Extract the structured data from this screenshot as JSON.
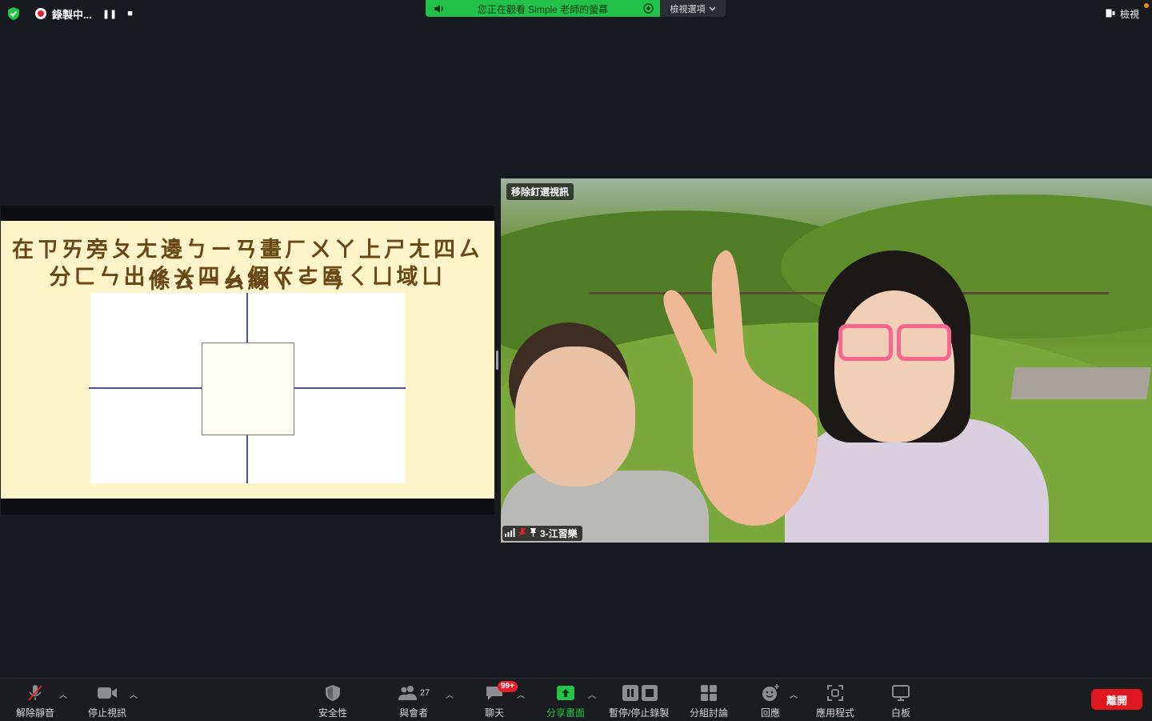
{
  "top_bar": {
    "recording_label": "錄製中...",
    "pause_symbol": "❚❚",
    "stop_symbol": "■",
    "banner_text": "您正在觀看 Simple 老師的螢幕",
    "view_options_label": "檢視選項",
    "view_label": "檢視"
  },
  "slide": {
    "title_line1": "在ㄗㄞ旁ㄆㄤ邊ㄅㄧㄢ畫ㄏㄨㄚ上ㄕㄤ四ㄙ條ㄊㄧㄠ線ㄒㄧㄢ",
    "title_line2": "分ㄈㄣ出ㄔㄨ四ㄙ個ㄍㄜ區ㄑㄩ域ㄩ"
  },
  "video": {
    "pin_label": "移除釘選視訊",
    "participant_name": "3-江習樂"
  },
  "toolbar": {
    "unmute_label": "解除靜音",
    "stop_video_label": "停止視訊",
    "security_label": "安全性",
    "participants_label": "與會者",
    "participants_count": "27",
    "chat_label": "聊天",
    "chat_badge": "99+",
    "share_label": "分享畫面",
    "record_label": "暫停/停止錄製",
    "breakout_label": "分組討論",
    "reactions_label": "回應",
    "apps_label": "應用程式",
    "whiteboard_label": "白板",
    "leave_label": "離開"
  },
  "colors": {
    "banner_green": "#22c24a",
    "leave_red": "#e0171e",
    "slide_bg": "#fdf5c9",
    "title_brown": "#6a4816",
    "line_blue": "#4a5489"
  }
}
